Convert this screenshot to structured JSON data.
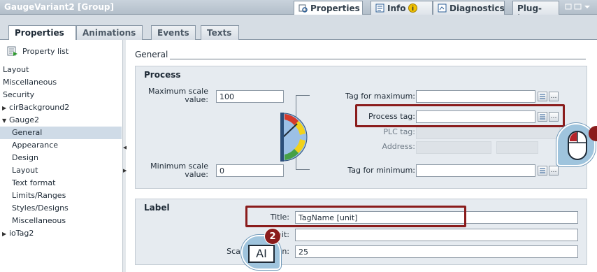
{
  "window": {
    "title": "GaugeVariant2 [Group]",
    "tabs": [
      {
        "label": "Properties"
      },
      {
        "label": "Info"
      },
      {
        "label": "Diagnostics"
      },
      {
        "label": "Plug-ins"
      }
    ]
  },
  "subtabs": [
    "Properties",
    "Animations",
    "Events",
    "Texts"
  ],
  "sidebar": {
    "property_list_label": "Property list",
    "items": [
      {
        "label": "Layout"
      },
      {
        "label": "Miscellaneous"
      },
      {
        "label": "Security"
      },
      {
        "label": "cirBackground2"
      },
      {
        "label": "Gauge2"
      },
      {
        "label": "General"
      },
      {
        "label": "Appearance"
      },
      {
        "label": "Design"
      },
      {
        "label": "Layout"
      },
      {
        "label": "Text format"
      },
      {
        "label": "Limits/Ranges"
      },
      {
        "label": "Styles/Designs"
      },
      {
        "label": "Miscellaneous"
      },
      {
        "label": "ioTag2"
      }
    ]
  },
  "main": {
    "section_title": "General",
    "process": {
      "title": "Process",
      "max_scale_label": "Maximum scale value:",
      "max_scale_value": "100",
      "min_scale_label": "Minimum scale value:",
      "min_scale_value": "0",
      "tag_max_label": "Tag for maximum:",
      "process_tag_label": "Process tag:",
      "plc_tag_label": "PLC tag:",
      "address_label": "Address:",
      "tag_min_label": "Tag for minimum:"
    },
    "label": {
      "title": "Label",
      "title_label": "Title:",
      "title_value": "TagName [unit]",
      "unit_label": "Unit:",
      "unit_value": "",
      "gradation_label": "Scale gradation:",
      "gradation_value": "25"
    }
  },
  "callouts": {
    "step2": "2",
    "text_cursor_glyph": "AI"
  },
  "colors": {
    "highlight": "#8a1c1c",
    "callout": "#9fc4dd"
  },
  "icons": [
    "property-list-icon",
    "info-icon",
    "diagnostics-icon",
    "browse-icon",
    "mouse-icon",
    "text-cursor-icon",
    "gauge-icon"
  ]
}
